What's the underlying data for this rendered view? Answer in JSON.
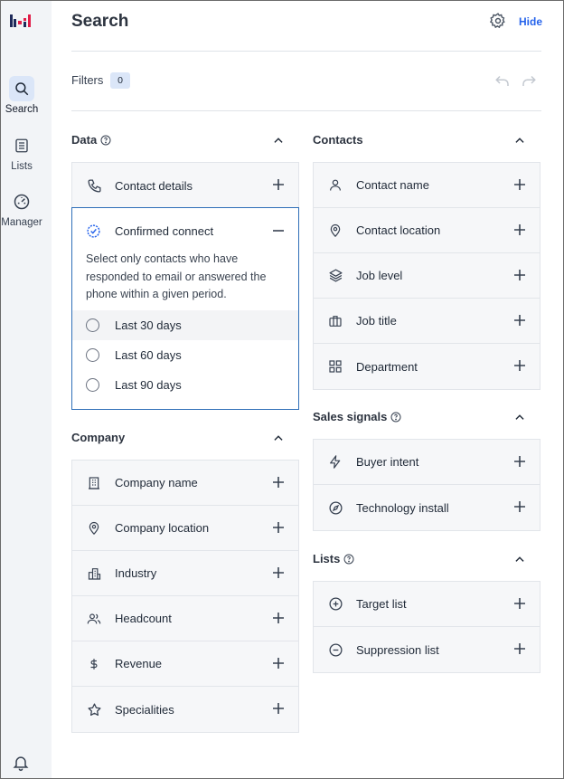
{
  "sidebar": {
    "nav": [
      {
        "label": "Search",
        "icon": "search-icon",
        "active": true
      },
      {
        "label": "Lists",
        "icon": "list-icon",
        "active": false
      },
      {
        "label": "Manager",
        "icon": "dashboard-icon",
        "active": false
      }
    ]
  },
  "header": {
    "title": "Search",
    "hide_label": "Hide"
  },
  "filters": {
    "label": "Filters",
    "count": "0"
  },
  "data_section": {
    "title": "Data",
    "items": [
      {
        "label": "Contact details",
        "icon": "phone-icon"
      }
    ],
    "confirmed_connect": {
      "label": "Confirmed connect",
      "description": "Select only contacts who have responded to email or answered the phone within a given period.",
      "options": [
        "Last 30 days",
        "Last 60 days",
        "Last 90 days"
      ]
    }
  },
  "company_section": {
    "title": "Company",
    "items": [
      {
        "label": "Company name",
        "icon": "building-icon"
      },
      {
        "label": "Company location",
        "icon": "location-pin-icon"
      },
      {
        "label": "Industry",
        "icon": "industry-icon"
      },
      {
        "label": "Headcount",
        "icon": "users-icon"
      },
      {
        "label": "Revenue",
        "icon": "dollar-icon"
      },
      {
        "label": "Specialities",
        "icon": "star-icon"
      }
    ]
  },
  "contacts_section": {
    "title": "Contacts",
    "items": [
      {
        "label": "Contact name",
        "icon": "user-icon"
      },
      {
        "label": "Contact location",
        "icon": "location-pin-icon"
      },
      {
        "label": "Job level",
        "icon": "layers-icon"
      },
      {
        "label": "Job title",
        "icon": "briefcase-icon"
      },
      {
        "label": "Department",
        "icon": "grid-icon"
      }
    ]
  },
  "sales_section": {
    "title": "Sales signals",
    "items": [
      {
        "label": "Buyer intent",
        "icon": "lightning-icon"
      },
      {
        "label": "Technology install",
        "icon": "compass-icon"
      }
    ]
  },
  "lists_section": {
    "title": "Lists",
    "items": [
      {
        "label": "Target list",
        "icon": "plus-circle-icon"
      },
      {
        "label": "Suppression list",
        "icon": "minus-circle-icon"
      }
    ]
  },
  "colors": {
    "accent": "#2563eb",
    "active_nav_bg": "#dbe6f8",
    "selected_border": "#2f6fb8"
  }
}
